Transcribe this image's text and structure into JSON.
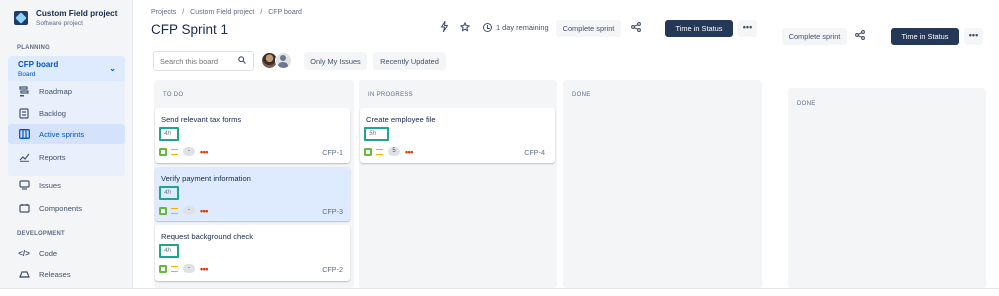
{
  "sidebar": {
    "project_name": "Custom Field project",
    "project_type": "Software project",
    "planning_label": "PLANNING",
    "board_name": "CFP board",
    "board_sub": "Board",
    "items": [
      {
        "label": "Roadmap",
        "icon": "roadmap-icon"
      },
      {
        "label": "Backlog",
        "icon": "backlog-icon"
      },
      {
        "label": "Active sprints",
        "icon": "board-columns-icon"
      },
      {
        "label": "Reports",
        "icon": "reports-icon"
      },
      {
        "label": "Issues",
        "icon": "issues-icon"
      },
      {
        "label": "Components",
        "icon": "components-icon"
      },
      {
        "label": "Code",
        "icon": "code-icon"
      },
      {
        "label": "Releases",
        "icon": "releases-icon"
      }
    ],
    "development_label": "DEVELOPMENT"
  },
  "breadcrumb": {
    "items": [
      "Projects",
      "Custom Field project",
      "CFP board"
    ],
    "separator": "/"
  },
  "header": {
    "title": "CFP Sprint 1",
    "remaining": "1 day remaining",
    "complete_sprint": "Complete sprint",
    "time_in_status": "Time in Status",
    "more": "•••"
  },
  "right_panel": {
    "complete_sprint": "Complete sprint",
    "time_in_status": "Time in Status",
    "more": "•••",
    "column_title": "DONE"
  },
  "filters": {
    "search_placeholder": "Search this board",
    "only_my_issues": "Only My Issues",
    "recently_updated": "Recently Updated"
  },
  "columns": [
    {
      "title": "TO DO"
    },
    {
      "title": "IN PROGRESS"
    },
    {
      "title": "DONE"
    }
  ],
  "cards": [
    {
      "title": "Send relevant tax forms",
      "estimate": "4h",
      "points": "-",
      "key": "CFP-1"
    },
    {
      "title": "Verify payment information",
      "estimate": "4h",
      "points": "-",
      "key": "CFP-3"
    },
    {
      "title": "Request background check",
      "estimate": "4h",
      "points": "-",
      "key": "CFP-2"
    },
    {
      "title": "Create employee file",
      "estimate": "5h",
      "points": "5",
      "key": "CFP-4"
    }
  ],
  "colors": {
    "accent": "#0052cc",
    "dark_button": "#253858",
    "estimate_highlight": "#21a38d",
    "story": "#63ba3c",
    "priority_medium": "#ffab00",
    "blocker": "#de350b"
  }
}
